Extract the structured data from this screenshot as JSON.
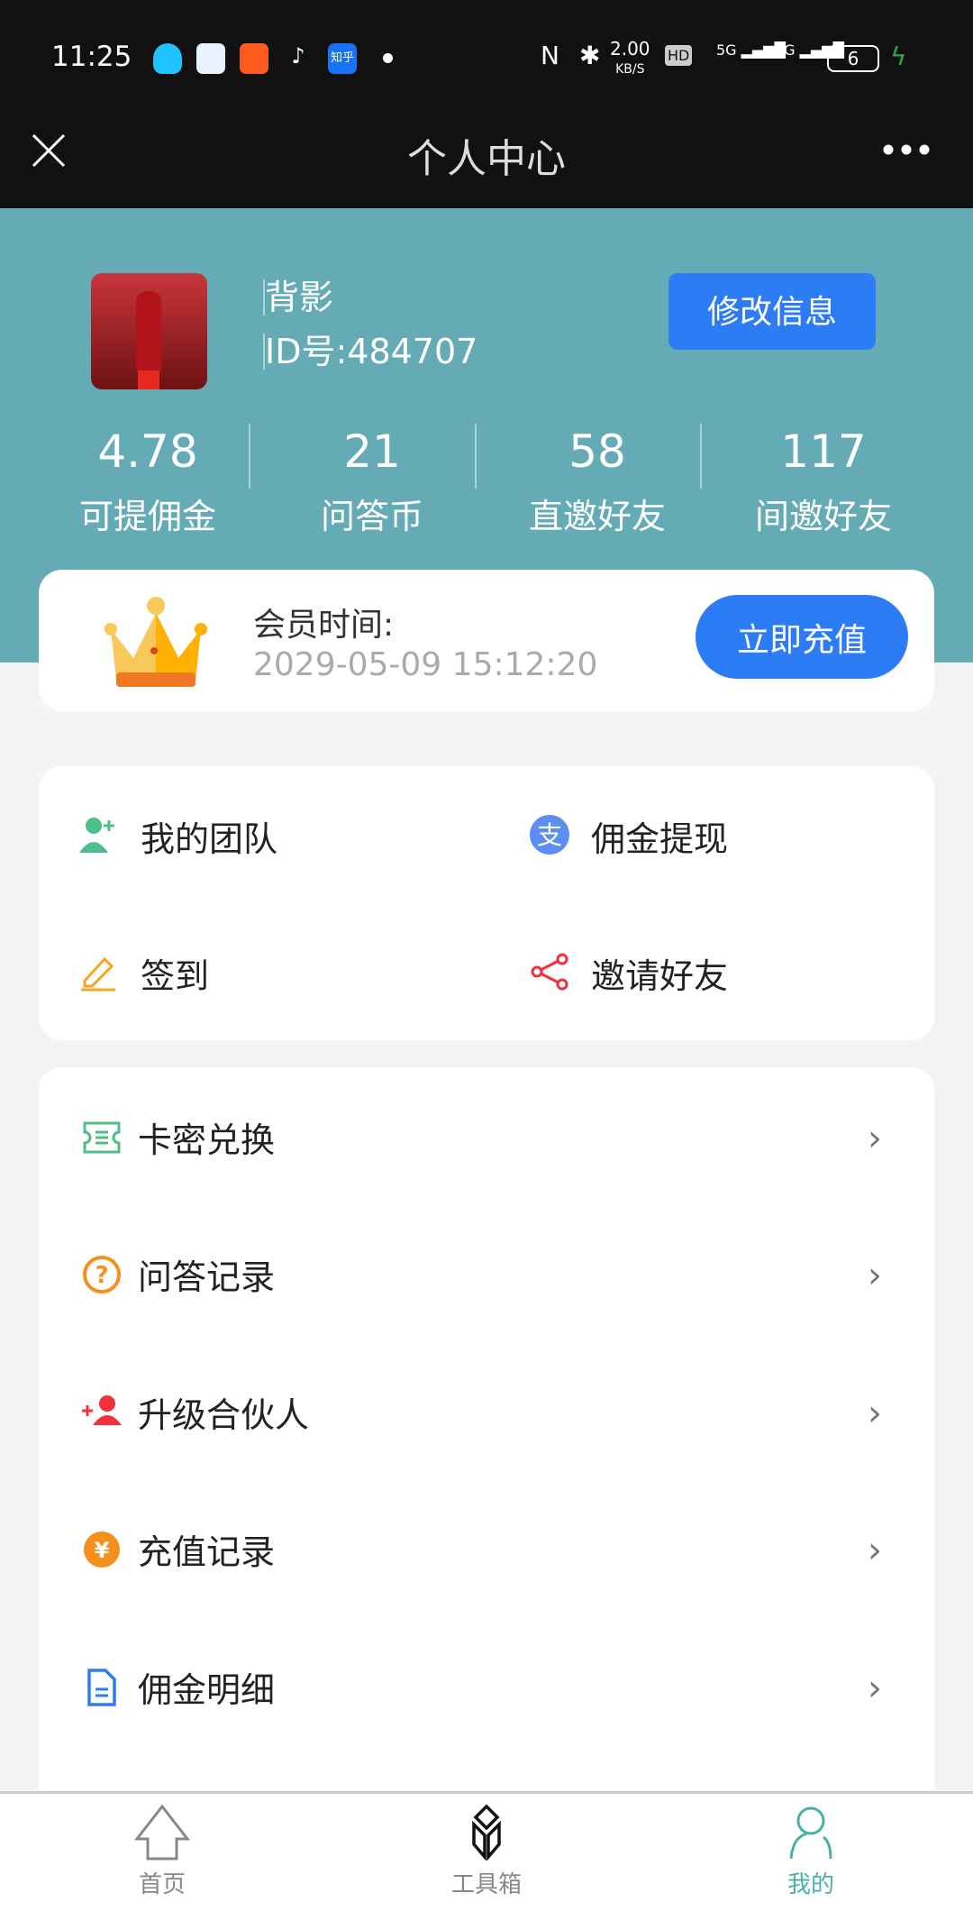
{
  "status_bar": {
    "time": "11:25",
    "net_speed": "2.00",
    "net_unit": "KB/S",
    "battery": "6",
    "network": [
      "5G",
      "5G"
    ]
  },
  "header": {
    "title": "个人中心",
    "close_icon": "close-icon",
    "more_icon": "more-icon"
  },
  "profile": {
    "name": "背影",
    "id": "ID号:484707",
    "edit_label": "修改信息"
  },
  "stats": [
    {
      "value": "4.78",
      "label": "可提佣金"
    },
    {
      "value": "21",
      "label": "问答币"
    },
    {
      "value": "58",
      "label": "直邀好友"
    },
    {
      "value": "117",
      "label": "间邀好友"
    }
  ],
  "membership": {
    "label": "会员时间:",
    "expiry": "2029-05-09 15:12:20",
    "recharge_label": "立即充值"
  },
  "grid": [
    {
      "label": "我的团队",
      "icon": "user-add-icon",
      "color": "#4cbf8a"
    },
    {
      "label": "佣金提现",
      "icon": "alipay-icon",
      "color": "#5b8ef0"
    },
    {
      "label": "签到",
      "icon": "pencil-icon",
      "color": "#f5a623"
    },
    {
      "label": "邀请好友",
      "icon": "share-icon",
      "color": "#f0313b"
    }
  ],
  "list": [
    {
      "label": "卡密兑换",
      "icon": "ticket-icon",
      "color": "#4cbf8a"
    },
    {
      "label": "问答记录",
      "icon": "question-icon",
      "color": "#f5901e"
    },
    {
      "label": "升级合伙人",
      "icon": "user-plus-icon",
      "color": "#f0313b"
    },
    {
      "label": "充值记录",
      "icon": "yuan-icon",
      "color": "#f5901e"
    },
    {
      "label": "佣金明细",
      "icon": "document-icon",
      "color": "#2f7cf0"
    }
  ],
  "nav": [
    {
      "label": "首页",
      "icon": "home-icon"
    },
    {
      "label": "工具箱",
      "icon": "toolbox-icon"
    },
    {
      "label": "我的",
      "icon": "user-icon",
      "active": true
    }
  ],
  "colors": {
    "teal": "#64abb5",
    "primary": "#2c7cf6",
    "active_nav": "#4bb0a8"
  }
}
